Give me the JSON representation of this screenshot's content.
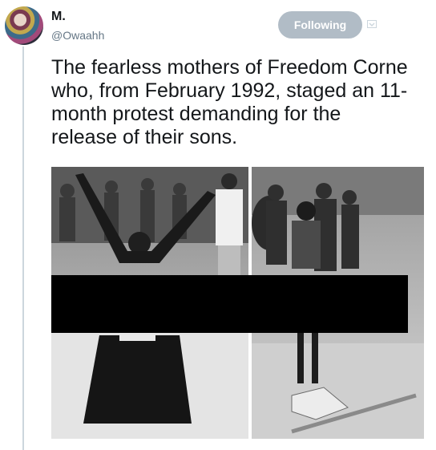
{
  "author": {
    "display_name": "M.",
    "handle": "@Owaahh"
  },
  "follow_button": {
    "label": "Following"
  },
  "tweet": {
    "lines": [
      "The fearless mothers of Freedom Corne",
      "who, from February 1992, staged an 11-",
      "month protest demanding for the",
      "release of their sons."
    ]
  },
  "icons": {
    "menu": "chevron-down-icon"
  },
  "colors": {
    "button_bg": "#b1bcc6",
    "text": "#14171a",
    "secondary_text": "#657786",
    "thread_line": "#ccd6dd"
  }
}
